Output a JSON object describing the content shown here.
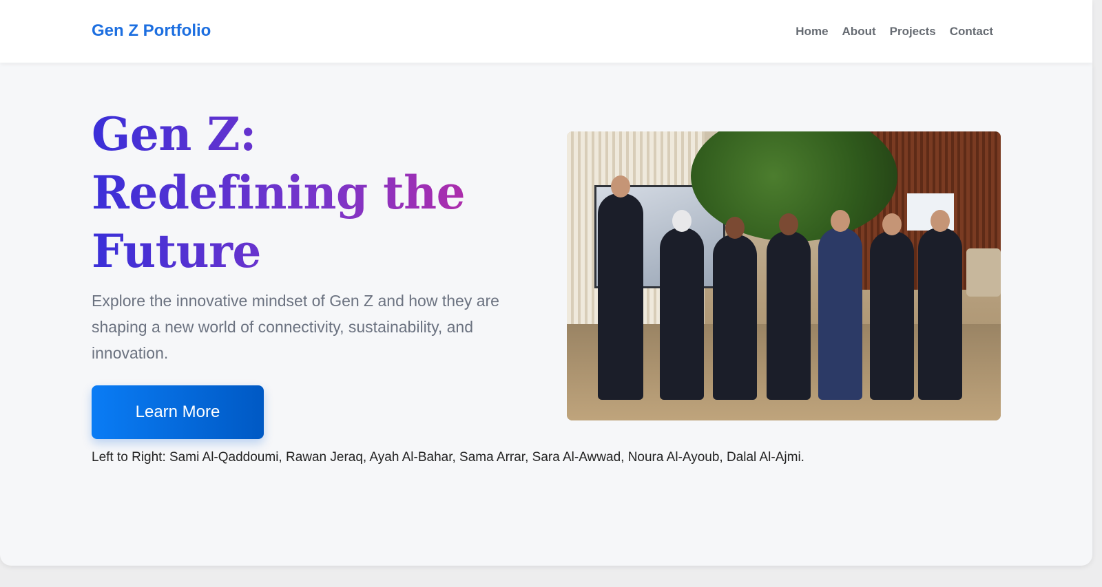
{
  "header": {
    "brand": "Gen Z Portfolio",
    "nav": [
      "Home",
      "About",
      "Projects",
      "Contact"
    ]
  },
  "hero": {
    "title_lines": [
      "Gen Z:",
      "Redefining the",
      "Future"
    ],
    "subtitle": "Explore the innovative mindset of Gen Z and how they are shaping a new world of connectivity, sustainability, and innovation.",
    "cta_label": "Learn More",
    "caption": "Left to Right: Sami Al-Qaddoumi, Rawan Jeraq, Ayah Al-Bahar, Sama Arrar, Sara Al-Awwad, Noura Al-Ayoub, Dalal Al-Ajmi.",
    "title_gradient": [
      "#3a2fd8",
      "#7a35c9",
      "#c02aa0"
    ],
    "brand_color": "#1d6fe0",
    "button_gradient": [
      "#0a7cf5",
      "#0059c4"
    ]
  }
}
